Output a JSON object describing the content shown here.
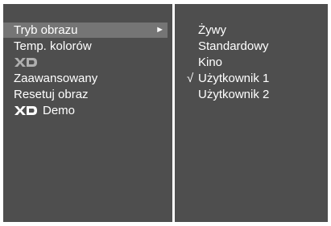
{
  "menu": {
    "items": [
      {
        "label": "Tryb obrazu",
        "submenu_arrow": "►",
        "selected": true
      },
      {
        "label": "Temp. kolorów"
      },
      {
        "logo": "XD"
      },
      {
        "label": "Zaawansowany"
      },
      {
        "label": "Resetuj obraz"
      },
      {
        "logo": "XD",
        "label": "Demo"
      }
    ]
  },
  "submenu": {
    "check_mark": "√",
    "options": [
      {
        "label": "Żywy"
      },
      {
        "label": "Standardowy"
      },
      {
        "label": "Kino"
      },
      {
        "label": "Użytkownik 1",
        "checked": true
      },
      {
        "label": "Użytkownik 2"
      }
    ]
  },
  "colors": {
    "panel_background": "#4e4e4e",
    "selected_background": "#757575",
    "text": "#ffffff",
    "divider": "#ffffff"
  }
}
